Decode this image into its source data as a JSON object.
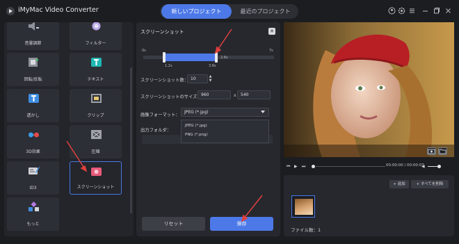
{
  "app": {
    "title": "iMyMac Video Converter"
  },
  "tabs": [
    {
      "label": "新しいプロジェクト"
    },
    {
      "label": "最近のプロジェクト"
    }
  ],
  "window_icons": [
    "user-icon",
    "settings-icon",
    "menu-icon",
    "minimize-icon",
    "restore-icon",
    "close-icon"
  ],
  "tools": [
    {
      "label": "音量調節",
      "icon": "volume-icon"
    },
    {
      "label": "フィルター",
      "icon": "filter-icon"
    },
    {
      "label": "回転/反転",
      "icon": "rotate-icon"
    },
    {
      "label": "テキスト",
      "icon": "text-icon"
    },
    {
      "label": "透かし",
      "icon": "watermark-icon"
    },
    {
      "label": "クリップ",
      "icon": "clip-icon"
    },
    {
      "label": "3D効果",
      "icon": "3d-icon"
    },
    {
      "label": "圧縮",
      "icon": "compress-icon"
    },
    {
      "label": "ID3",
      "icon": "id3-icon"
    },
    {
      "label": "スクリーンショット",
      "icon": "screenshot-icon",
      "active": true
    },
    {
      "label": "もっと",
      "icon": "more-icon"
    }
  ],
  "dialog": {
    "title": "スクリーンショット",
    "range": {
      "min_label": "0s",
      "max_label": "7s",
      "start_label": "1.2s",
      "end_label": "3.8s",
      "mid_label": "2.6s",
      "start": 1.2,
      "end": 3.8,
      "max": 7
    },
    "count_label": "スクリーンショット数：",
    "count_value": "10",
    "size_label": "スクリーンショットのサイズ：",
    "width_value": "960",
    "x_sep": "x",
    "height_value": "540",
    "format_label": "画像フォーマット：",
    "format_value": "JPEG (*.jpg)",
    "format_options": [
      "JPEG (*.jpg)",
      "PNG (*.png)"
    ],
    "output_label": "出力フォルダ：",
    "reset_label": "リセット",
    "save_label": "保存"
  },
  "player": {
    "time": "00:00:00 / 00:00:07"
  },
  "shots": {
    "add_label": "+ 追加",
    "delete_all_label": "+ すべてを削除",
    "file_count_label": "ファイル数：1"
  },
  "colors": {
    "accent": "#4d79e8",
    "background": "#1c1d21",
    "panel": "#26282e",
    "annotation": "#e0403e"
  }
}
